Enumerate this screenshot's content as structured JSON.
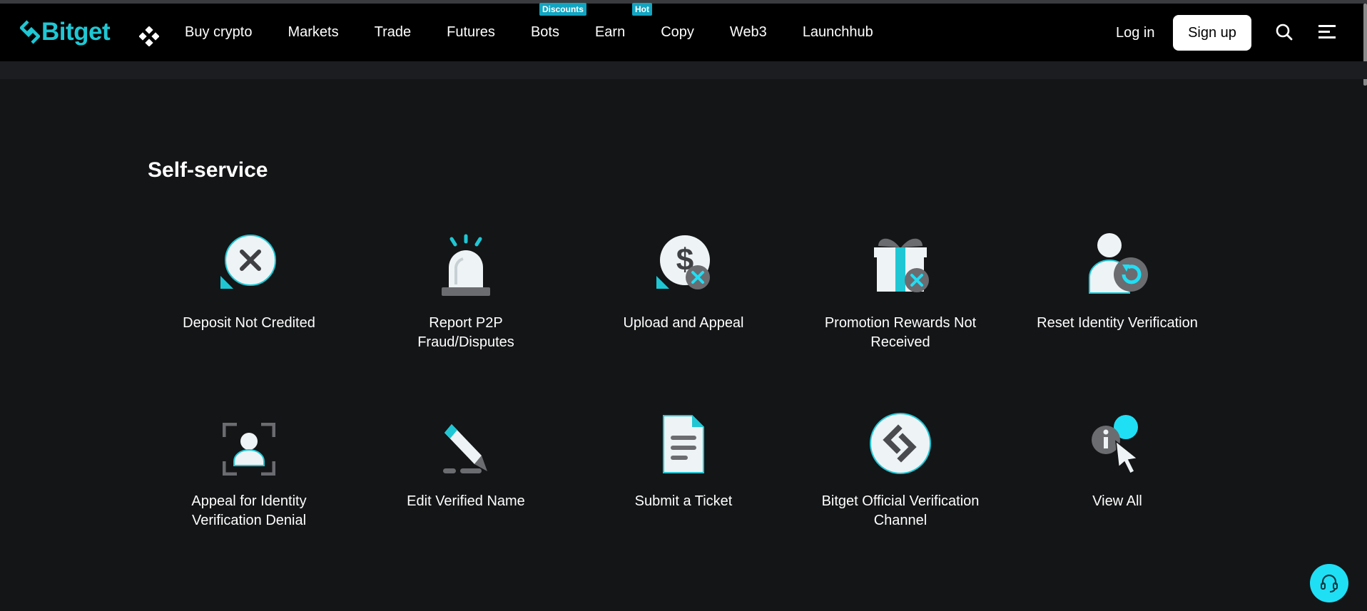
{
  "brand": {
    "name": "Bitget",
    "accent": "#1fc7d4"
  },
  "nav": {
    "items": [
      {
        "label": "Buy crypto"
      },
      {
        "label": "Markets"
      },
      {
        "label": "Trade"
      },
      {
        "label": "Futures"
      },
      {
        "label": "Bots",
        "badge": "Discounts"
      },
      {
        "label": "Earn",
        "badge": "Hot"
      },
      {
        "label": "Copy"
      },
      {
        "label": "Web3"
      },
      {
        "label": "Launchhub"
      }
    ],
    "login": "Log in",
    "signup": "Sign up"
  },
  "selfservice": {
    "title": "Self-service",
    "items": [
      {
        "label": "Deposit Not Credited",
        "icon": "deposit-not-credited-icon"
      },
      {
        "label": "Report P2P Fraud/Disputes",
        "icon": "alarm-siren-icon"
      },
      {
        "label": "Upload and Appeal",
        "icon": "dollar-appeal-icon"
      },
      {
        "label": "Promotion Rewards Not Received",
        "icon": "gift-x-icon"
      },
      {
        "label": "Reset Identity Verification",
        "icon": "user-reset-icon"
      },
      {
        "label": "Appeal for Identity Verification Denial",
        "icon": "identity-frame-icon"
      },
      {
        "label": "Edit Verified Name",
        "icon": "pencil-edit-icon"
      },
      {
        "label": "Submit a Ticket",
        "icon": "document-ticket-icon"
      },
      {
        "label": "Bitget Official Verification Channel",
        "icon": "bitget-logo-icon"
      },
      {
        "label": "View All",
        "icon": "info-cursor-icon"
      }
    ]
  }
}
